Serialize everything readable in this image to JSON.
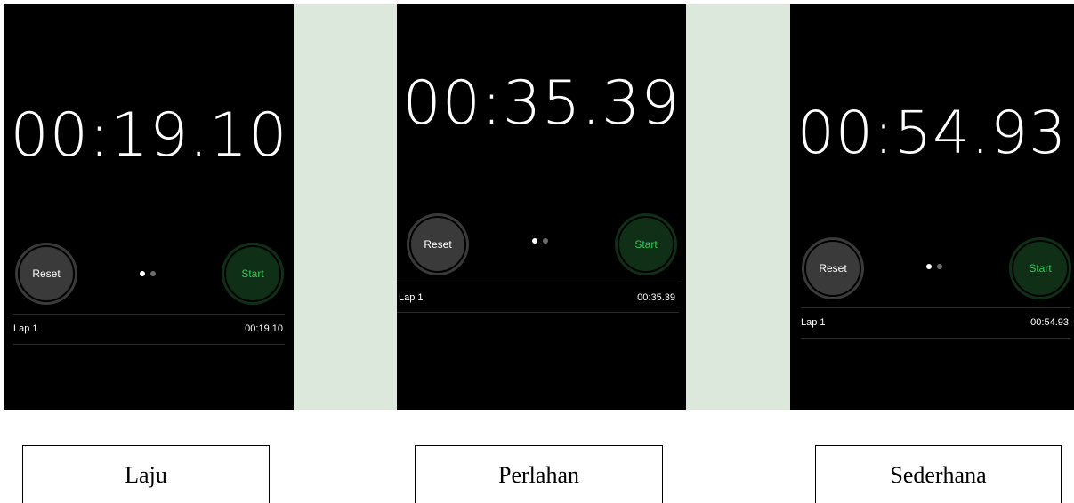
{
  "colors": {
    "phone_background": "#000000",
    "gap_background": "#dbe8db",
    "reset_button": "#3a3a3a",
    "start_button": "#0f2f17",
    "start_text": "#33c759",
    "text": "#ffffff"
  },
  "panels": [
    {
      "time": "00:19.10",
      "reset_label": "Reset",
      "start_label": "Start",
      "lap_label": "Lap 1",
      "lap_time": "00:19.10",
      "caption": "Laju"
    },
    {
      "time": "00:35.39",
      "reset_label": "Reset",
      "start_label": "Start",
      "lap_label": "Lap 1",
      "lap_time": "00:35.39",
      "caption": "Perlahan"
    },
    {
      "time": "00:54.93",
      "reset_label": "Reset",
      "start_label": "Start",
      "lap_label": "Lap 1",
      "lap_time": "00:54.93",
      "caption": "Sederhana"
    }
  ]
}
